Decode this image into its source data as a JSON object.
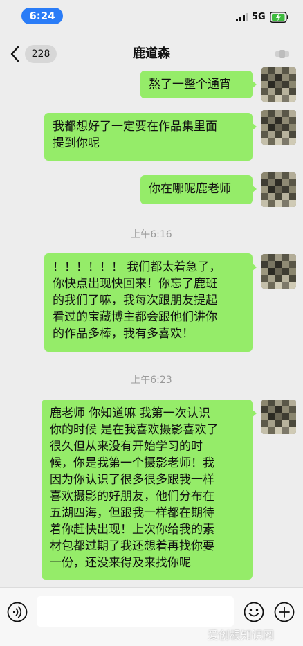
{
  "status_bar": {
    "time": "6:24",
    "network": "5G",
    "accent_color": "#2a7cf7"
  },
  "nav": {
    "unread_count": "228",
    "title": "鹿道森",
    "back_icon": "chevron-left-icon",
    "more_icon": "more-dots-icon"
  },
  "messages": [
    {
      "text": "熬了一整个通宵"
    },
    {
      "text": "我都想好了一定要在作品集里面\n提到你呢"
    },
    {
      "text": "你在哪呢鹿老师"
    },
    {
      "timestamp": "上午6:16"
    },
    {
      "text": "！！！！！！ 我们都太着急了，\n你快点出现快回来！你忘了鹿班\n的我们了嘛，我每次跟朋友提起\n看过的宝藏博主都会跟他们讲你\n的作品多棒，我有多喜欢！"
    },
    {
      "timestamp": "上午6:23"
    },
    {
      "text": "鹿老师 你知道嘛 我第一次认识\n你的时候 是在我喜欢摄影喜欢了\n很久但从来没有开始学习的时\n候，你是我第一个摄影老师！我\n因为你认识了很多很多跟我一样\n喜欢摄影的好朋友，他们分布在\n五湖四海，但跟我一样都在期待\n着你赶快出现！上次你给我的素\n材包都过期了我还想着再找你要\n一份，还没来得及来找你呢"
    }
  ],
  "colors": {
    "bubble_sent": "#95ec69",
    "background": "#ededed",
    "timestamp": "#999999"
  },
  "input_bar": {
    "placeholder": "",
    "voice_icon": "voice-icon",
    "emoji_icon": "emoji-icon",
    "add_icon": "add-icon"
  },
  "watermark": "爱创根知识网"
}
